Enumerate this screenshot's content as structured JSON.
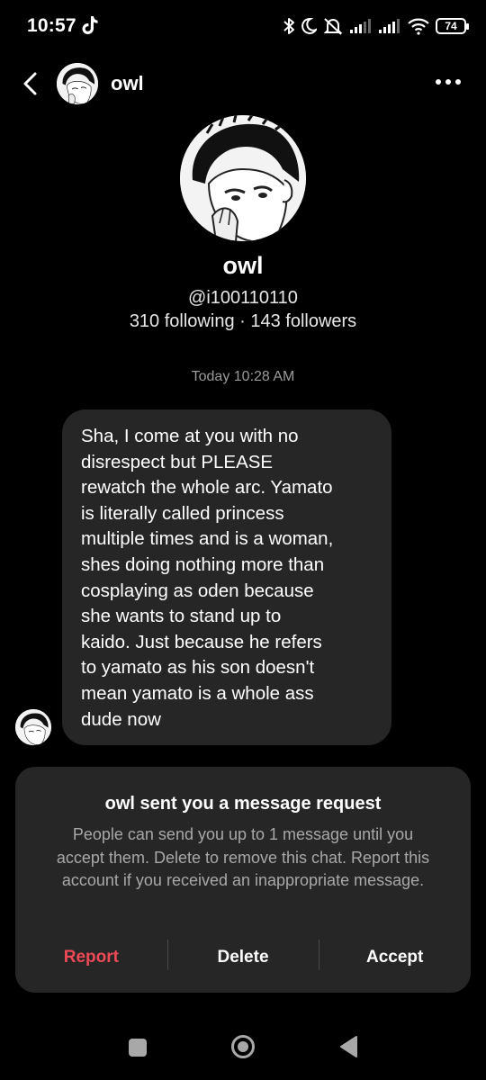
{
  "status_bar": {
    "time": "10:57",
    "battery": "74",
    "icons": [
      "tiktok-icon",
      "bluetooth-icon",
      "moon-icon",
      "mute-icon",
      "signal-icon",
      "signal-icon",
      "wifi-icon",
      "battery-icon"
    ]
  },
  "header": {
    "back_icon": "chevron-left-icon",
    "name": "owl",
    "more_icon": "more-horizontal-icon"
  },
  "profile": {
    "name": "owl",
    "handle": "@i100110110",
    "stats": "310 following · 143 followers"
  },
  "thread": {
    "timestamp": "Today 10:28 AM",
    "message": "Sha, I come at you with no\ndisrespect but PLEASE\nrewatch the whole arc. Yamato\nis literally called princess\nmultiple times and is a woman,\nshes doing nothing more than\ncosplaying as oden because\nshe wants to stand up to\nkaido. Just because he refers\nto yamato as his son doesn't\nmean yamato is a whole ass\ndude now"
  },
  "request": {
    "title": "owl sent you a message request",
    "description": "People can send you up to 1 message until you accept them. Delete to remove this chat. Report this account if you received an inappropriate message.",
    "report_label": "Report",
    "delete_label": "Delete",
    "accept_label": "Accept"
  },
  "colors": {
    "background": "#000000",
    "bubble": "#262626",
    "card": "#262626",
    "report": "#ed4956",
    "muted_text": "#a8a8a8"
  },
  "nav_bar": {
    "icons": [
      "recents-square-icon",
      "home-circle-icon",
      "back-triangle-icon"
    ]
  }
}
